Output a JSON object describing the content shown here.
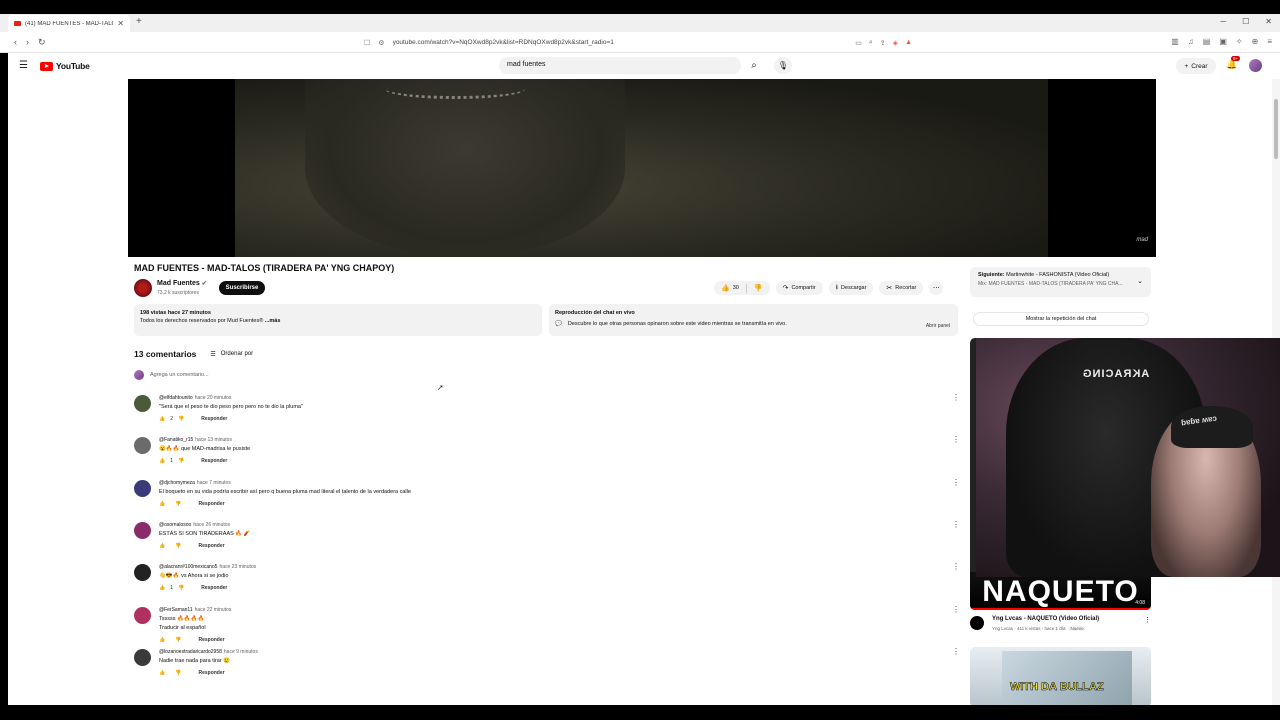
{
  "browser": {
    "tab_title": "(41) MAD FUENTES - MAD-TALO",
    "url": "youtube.com/watch?v=NqOXwd8p2vk&list=RDNqOXwd8p2vk&start_radio=1"
  },
  "masthead": {
    "logo_text": "YouTube",
    "search_value": "mad fuentes",
    "create_label": "Crear",
    "notif_badge": "9+"
  },
  "video": {
    "title": "MAD FUENTES - MAD-TALOS (TIRADERA PA' YNG CHAPOY)",
    "channel": "Mad Fuentes",
    "subscribers": "73,2 k suscriptores",
    "subscribe_label": "Suscribirse",
    "likes": "30",
    "share_label": "Compartir",
    "download_label": "Descargar",
    "clip_label": "Recortar",
    "views_time": "198 vistas  hace 27 minutos",
    "rights": "Todos los derechos reservados por Mud Fuentes® ",
    "more_label": "...más"
  },
  "chat_replay": {
    "heading": "Reproducción del chat en vivo",
    "text": "Descubre lo que otras personas opinaron sobre este video mientras se transmitía en vivo.",
    "open_label": "Abrir panel"
  },
  "comments": {
    "count_label": "13 comentarios",
    "sort_label": "Ordenar por",
    "add_placeholder": "Agrega un comentario...",
    "reply_label": "Responder",
    "items": [
      {
        "user": "@elfdahtounito",
        "time": "hace 20 minutos",
        "text": "\"Será que el peso te dio peso pero pero no te dio la pluma\"",
        "text2": "",
        "likes": "2"
      },
      {
        "user": "@Fanatiko_r15",
        "time": "hace 13 minutos",
        "text": "😮🔥🔥 que MAD-madrisa le pusiste",
        "text2": "",
        "likes": "1"
      },
      {
        "user": "@djchomymeza",
        "time": "hace 7 minutos",
        "text": "El boqueto en su vida podría escribir así pero q buena pluma mad literal el talento de la verdadera calle",
        "text2": "",
        "likes": ""
      },
      {
        "user": "@osornalosoo",
        "time": "hace 26 minutos",
        "text": "ESTÁS SI SON TIRADERAAS 🔥 🧨",
        "text2": "",
        "likes": ""
      },
      {
        "user": "@alacranr#100mexicano5",
        "time": "hace 23 minutos",
        "text": "👋😎🔥 vs Ahora si se jodio",
        "text2": "",
        "likes": "1"
      },
      {
        "user": "@FerSaman11",
        "time": "hace 22 minutos",
        "text": "Tsssss 🔥🔥🔥🔥",
        "text2": "Traducir al español",
        "likes": ""
      },
      {
        "user": "@lozanoestradaricardo2958",
        "time": "hace 9 minutos",
        "text": "Nadie trae nada para tirar 😢",
        "text2": "",
        "likes": ""
      }
    ]
  },
  "sidebar": {
    "next_label": "Siguiente:",
    "next_title": "Martinwhite - FASHONISTA (Video Oficial)",
    "next_mix": "Mix: MAD FUENTES - MAD-TALOS (TIRADERA PA' YNG CHA...",
    "show_chat": "Mostrar la repetición del chat",
    "video1_art": "NAQUETO",
    "video1_duration": "4:08",
    "video1_title": "Yng Lvcas - NAQUETO (Video Oficial)",
    "video1_meta": "Yng Lvcas · 411 k vistas · hace 1 día",
    "video1_new": "Nuevo",
    "video2_art": "WITH DA BULLAZ"
  },
  "webcam": {
    "chair_brand": "AKRACING",
    "cap_art": "ɓɐɓɐ ʍɐɔ"
  },
  "player": {
    "watermark": "mad"
  }
}
